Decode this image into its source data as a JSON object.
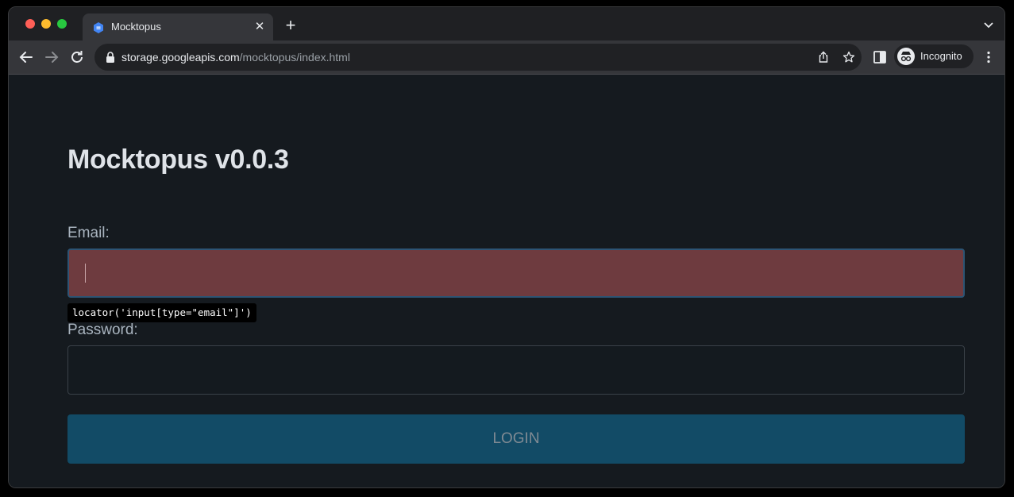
{
  "browser": {
    "tab_title": "Mocktopus",
    "tab_close": "✕",
    "new_tab": "+",
    "url_host": "storage.googleapis.com",
    "url_path": "/mocktopus/index.html",
    "profile_label": "Incognito",
    "icons": [
      "back-arrow-icon",
      "forward-arrow-icon",
      "reload-icon",
      "lock-icon",
      "share-icon",
      "star-icon",
      "side-panel-icon",
      "incognito-icon",
      "more-vert-icon",
      "chevron-down-icon"
    ]
  },
  "page": {
    "title": "Mocktopus v0.0.3",
    "email_label": "Email:",
    "email_value": "",
    "password_label": "Password:",
    "password_value": "",
    "login_label": "LOGIN",
    "locator_tooltip": "locator('input[type=\"email\"]')"
  },
  "colors": {
    "email_highlight": "#6e3b3f",
    "login_button": "#124b66",
    "page_background": "#151a1f"
  }
}
